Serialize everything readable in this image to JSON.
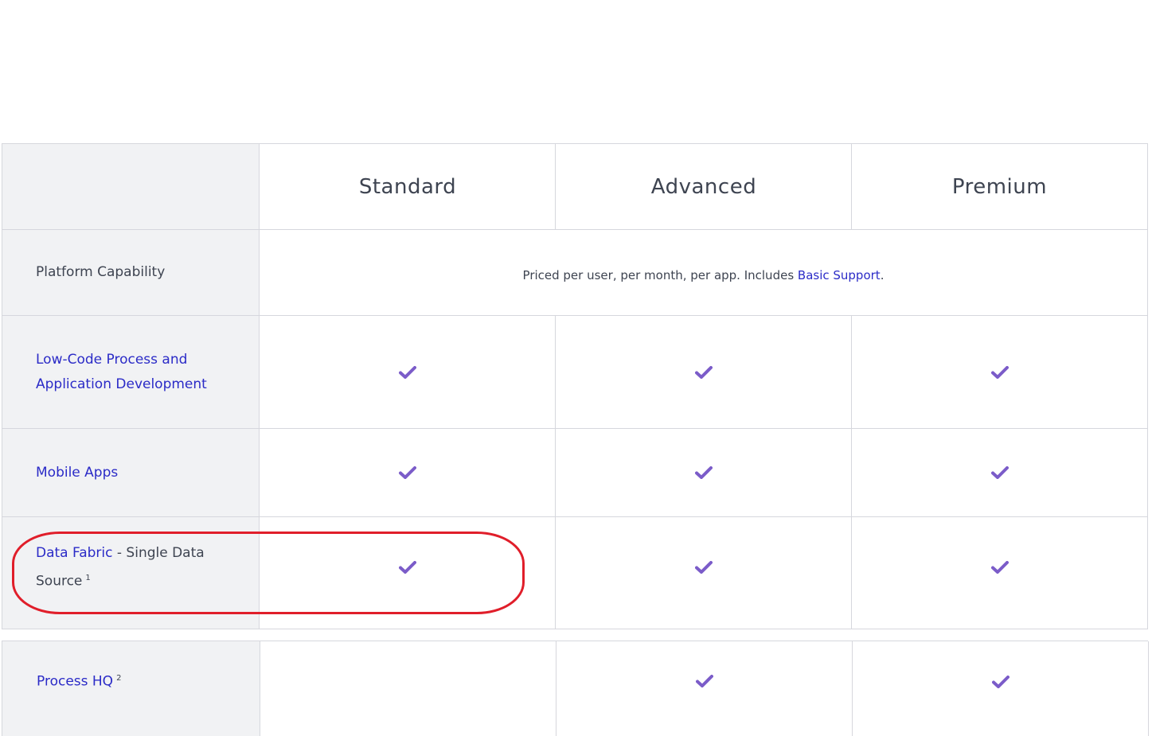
{
  "plans": [
    "Standard",
    "Advanced",
    "Premium"
  ],
  "platform": {
    "label": "Platform Capability",
    "note_prefix": "Priced per user, per month, per app. Includes ",
    "note_link": "Basic Support",
    "note_suffix": "."
  },
  "features": [
    {
      "label_link": "Low-Code Process and Application Development",
      "label_rest": "",
      "sup": "",
      "checks": [
        true,
        true,
        true
      ]
    },
    {
      "label_link": "Mobile Apps",
      "label_rest": "",
      "sup": "",
      "checks": [
        true,
        true,
        true
      ]
    },
    {
      "label_link": "Data Fabric",
      "label_rest": " - Single Data Source",
      "sup": "1",
      "checks": [
        true,
        true,
        true
      ]
    },
    {
      "label_link": "Process HQ",
      "label_rest": "",
      "sup": "2",
      "checks": [
        false,
        true,
        true
      ]
    }
  ],
  "colors": {
    "check": "#7b5cc9",
    "link": "#2b2bc7",
    "highlight": "#e01e2a"
  }
}
